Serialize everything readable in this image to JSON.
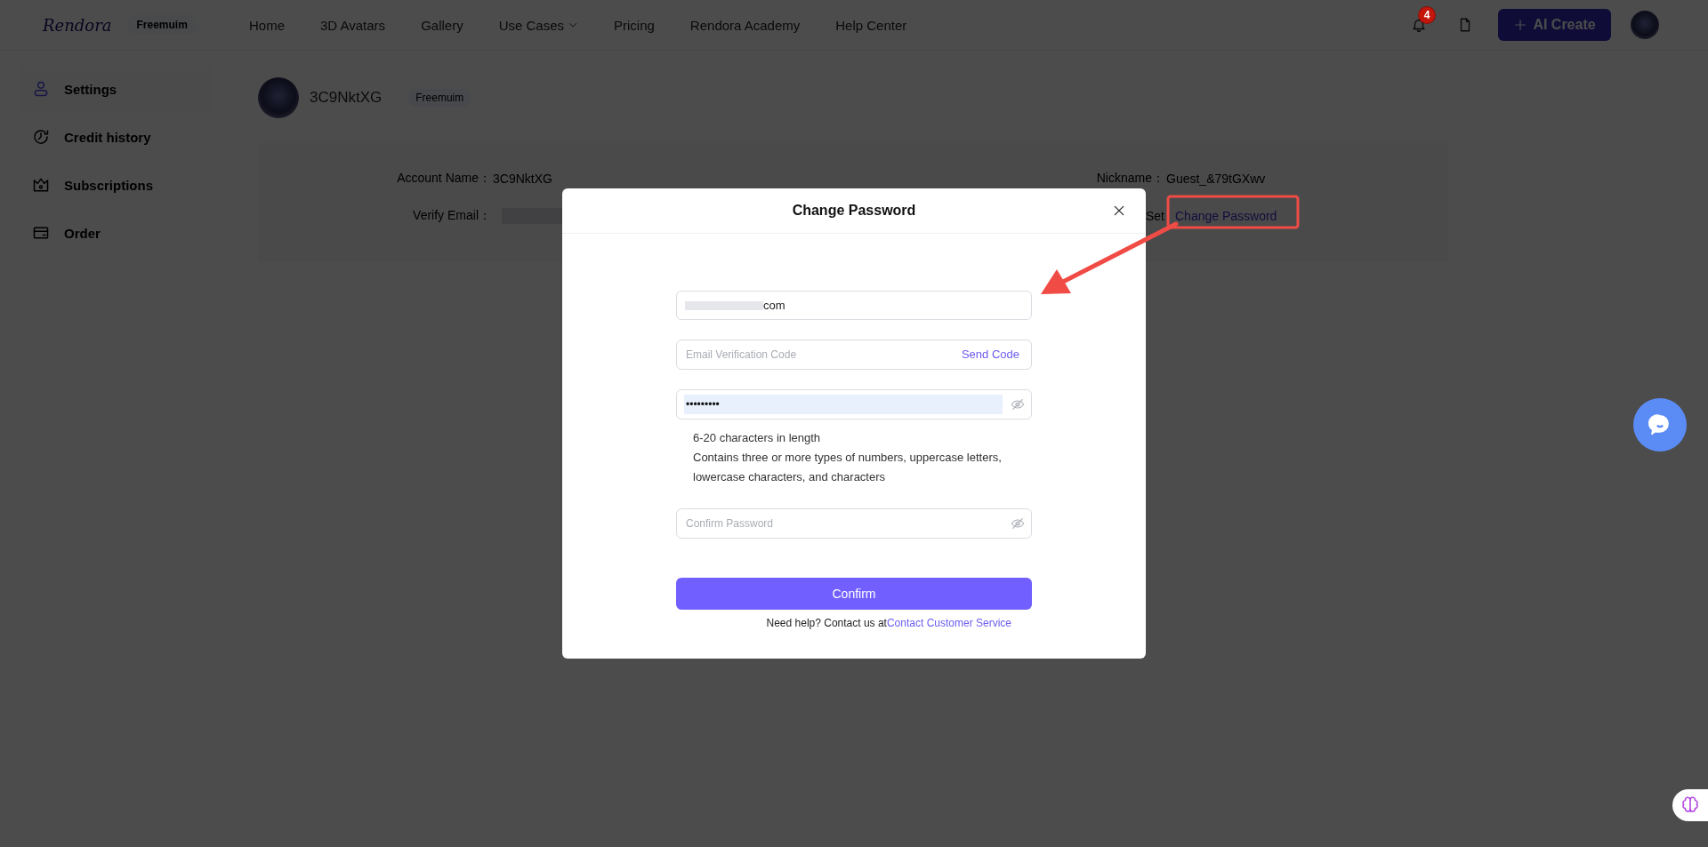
{
  "header": {
    "logo": "Rendora",
    "plan_badge": "Freemuim",
    "nav": [
      {
        "label": "Home",
        "dropdown": false
      },
      {
        "label": "3D Avatars",
        "dropdown": false
      },
      {
        "label": "Gallery",
        "dropdown": false
      },
      {
        "label": "Use Cases",
        "dropdown": true
      },
      {
        "label": "Pricing",
        "dropdown": false
      },
      {
        "label": "Rendora Academy",
        "dropdown": false
      },
      {
        "label": "Help Center",
        "dropdown": false
      }
    ],
    "notification_count": "4",
    "create_button": "AI Create"
  },
  "sidebar": {
    "items": [
      {
        "label": "Settings",
        "selected": true
      },
      {
        "label": "Credit history",
        "selected": false
      },
      {
        "label": "Subscriptions",
        "selected": false
      },
      {
        "label": "Order",
        "selected": false
      }
    ]
  },
  "profile": {
    "username": "3C9NktXG",
    "plan_badge": "Freemuim"
  },
  "account": {
    "columns": [
      [
        {
          "label": "Account Name：",
          "value": "3C9NktXG",
          "kind": "text"
        },
        {
          "label": "Verify Email：",
          "kind": "redacted"
        }
      ],
      [
        {
          "label": "Nickname：",
          "value": "Guest_&79tGXwv",
          "kind": "text"
        },
        {
          "label": "Set",
          "value": "Change Password",
          "kind": "link",
          "highlighted": true
        }
      ]
    ]
  },
  "modal": {
    "title": "Change Password",
    "fields": [
      {
        "kind": "email",
        "value": "com",
        "redacted": true
      },
      {
        "kind": "code",
        "placeholder": "Email Verification Code",
        "action": "Send Code"
      },
      {
        "kind": "password",
        "value": "•••••••••",
        "autofilled": true
      },
      {
        "kind": "hints",
        "lines": [
          "6-20 characters in length",
          "Contains three or more types of numbers, uppercase letters, lowercase characters, and characters"
        ]
      },
      {
        "kind": "password",
        "placeholder": "Confirm Password",
        "autofilled": false
      }
    ],
    "button": "Confirm",
    "help_text": "Need help? Contact us at",
    "help_link": "Contact Customer Service"
  }
}
